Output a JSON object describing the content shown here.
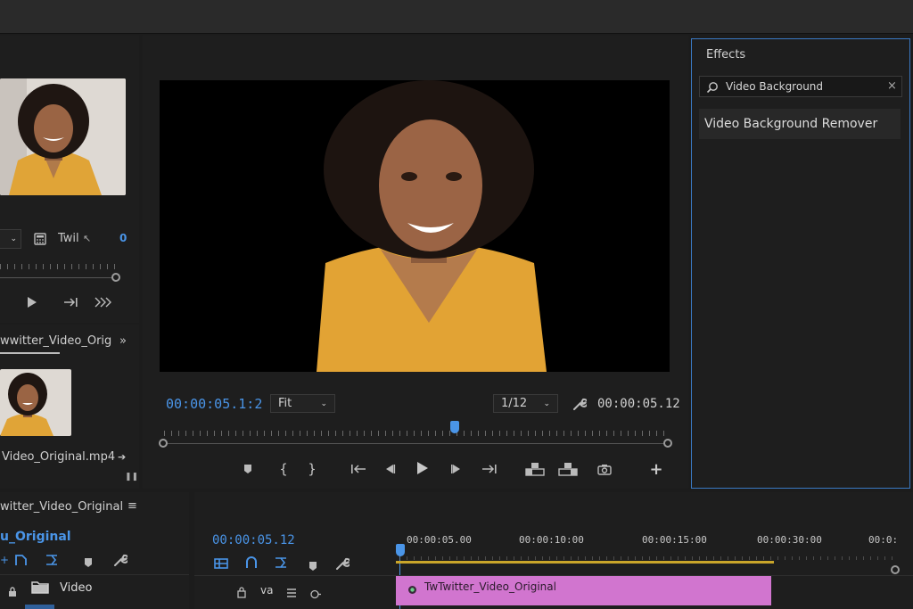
{
  "source_panel": {
    "timecode_value": "0",
    "label": "Twil",
    "filename_header": "wwitter_Video_Origin",
    "file_label": "Video_Original.mp4"
  },
  "program_monitor": {
    "timecode_left": "00:00:05.1:2",
    "fit_label": "Fit",
    "resolution_label": "1/12",
    "timecode_right": "00:00:05.12"
  },
  "effects": {
    "title": "Effects",
    "search_value": "Video Background",
    "result": "Video Background Remover"
  },
  "project": {
    "title": "witter_Video_Original",
    "sequence_label": "u_Original",
    "bin_label": "Video"
  },
  "timeline": {
    "timecode": "00:00:05.12",
    "ruler_labels": [
      "00:00:05.00",
      "00:00:10:00",
      "00:00:15:00",
      "00:00:30:00",
      "00:0:"
    ],
    "track_label": "va",
    "clip_name": "TwTwitter_Video_Original"
  },
  "colors": {
    "accent_blue": "#4a95e8",
    "clip_pink": "#d175cf",
    "work_area_yellow": "#c9a52a",
    "panel_border_blue": "#3a79c4"
  }
}
